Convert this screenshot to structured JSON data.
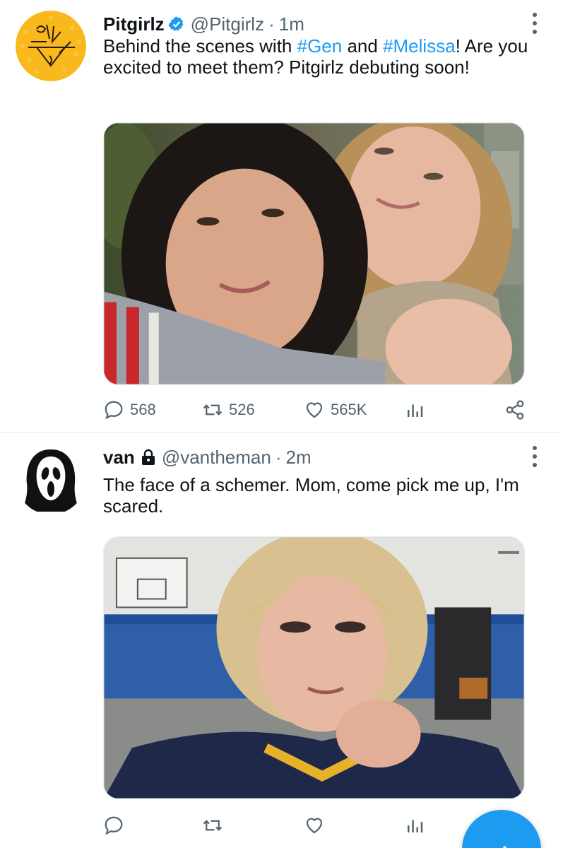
{
  "tweets": [
    {
      "display_name": "Pitgirlz",
      "handle": "@Pitgirlz",
      "separator": "·",
      "time": "1m",
      "verified": true,
      "text_parts": [
        {
          "text": "Behind the scenes with ",
          "type": "text"
        },
        {
          "text": "#Gen",
          "type": "hashtag"
        },
        {
          "text": " and ",
          "type": "text"
        },
        {
          "text": "#Melissa",
          "type": "hashtag"
        },
        {
          "text": "! Are you excited to meet them? Pitgirlz debuting soon!",
          "type": "text"
        }
      ],
      "replies": "568",
      "retweets": "526",
      "likes": "565K"
    },
    {
      "display_name": "van",
      "handle": "@vantheman",
      "separator": "·",
      "time": "2m",
      "protected": true,
      "text_parts": [
        {
          "text": "The face of a schemer. Mom, come pick me up, I'm scared.",
          "type": "text"
        }
      ],
      "replies": "",
      "retweets": "",
      "likes": ""
    }
  ],
  "colors": {
    "accent": "#1d9bf0",
    "muted": "#536471",
    "text": "#0f1419",
    "avatar_yellow": "#f9b81b"
  },
  "icons": {
    "reply": "speech-bubble-icon",
    "retweet": "retweet-icon",
    "like": "heart-icon",
    "stats": "bar-chart-icon",
    "share": "share-icon",
    "more": "vertical-dots-icon"
  }
}
